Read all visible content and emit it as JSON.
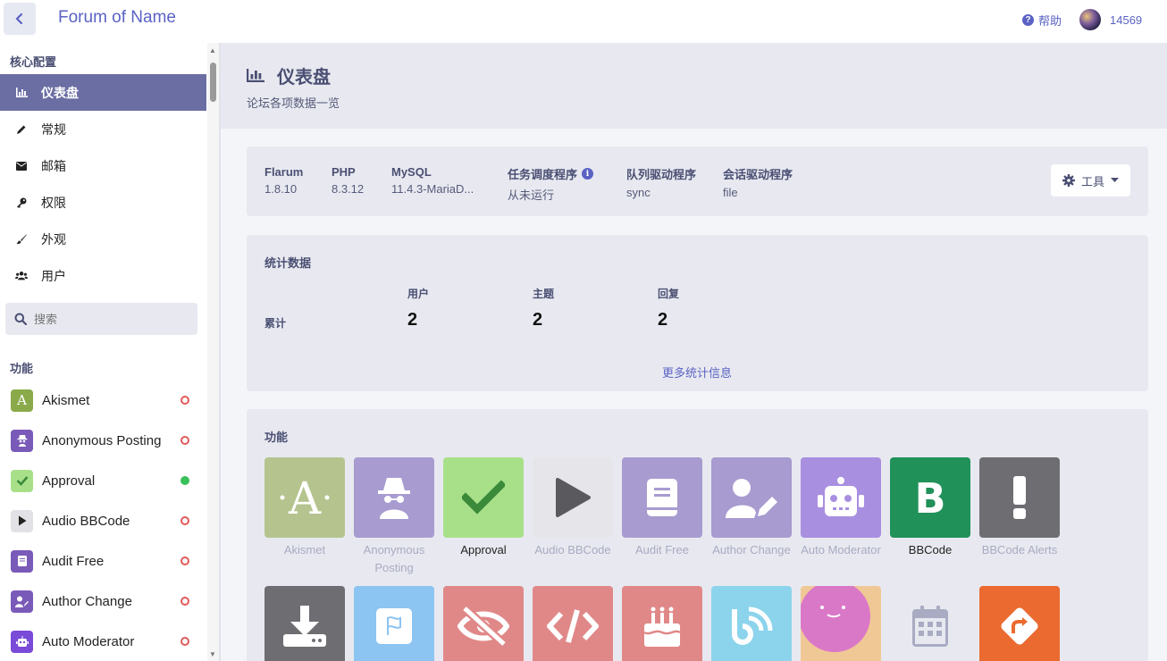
{
  "header": {
    "forum_title": "Forum of Name",
    "help_label": "帮助",
    "username": "14569"
  },
  "sidebar": {
    "core_heading": "核心配置",
    "nav": [
      {
        "label": "仪表盘",
        "icon": "chart-bar-icon",
        "active": true
      },
      {
        "label": "常规",
        "icon": "pencil-icon"
      },
      {
        "label": "邮箱",
        "icon": "envelope-icon"
      },
      {
        "label": "权限",
        "icon": "key-icon"
      },
      {
        "label": "外观",
        "icon": "paintbrush-icon"
      },
      {
        "label": "用户",
        "icon": "users-icon"
      }
    ],
    "search_placeholder": "搜索",
    "features_heading": "功能",
    "extensions": [
      {
        "label": "Akismet",
        "enabled": false,
        "color": "#a9c07a"
      },
      {
        "label": "Anonymous Posting",
        "enabled": false,
        "color": "#7a5ab8"
      },
      {
        "label": "Approval",
        "enabled": true,
        "color": "#a8e08a"
      },
      {
        "label": "Audio BBCode",
        "enabled": false,
        "color": "#e2e2e6"
      },
      {
        "label": "Audit Free",
        "enabled": false,
        "color": "#7a5ab8"
      },
      {
        "label": "Author Change",
        "enabled": false,
        "color": "#7a5ab8"
      },
      {
        "label": "Auto Moderator",
        "enabled": false,
        "color": "#7a4ad8"
      }
    ]
  },
  "page": {
    "title": "仪表盘",
    "subtitle": "论坛各项数据一览"
  },
  "status": {
    "items": [
      {
        "label": "Flarum",
        "value": "1.8.10"
      },
      {
        "label": "PHP",
        "value": "8.3.12"
      },
      {
        "label": "MySQL",
        "value": "11.4.3-MariaD..."
      },
      {
        "label": "任务调度程序",
        "value": "从未运行",
        "info": true
      },
      {
        "label": "队列驱动程序",
        "value": "sync"
      },
      {
        "label": "会话驱动程序",
        "value": "file"
      }
    ],
    "tools_label": "工具"
  },
  "stats": {
    "heading": "统计数据",
    "columns": [
      "用户",
      "主题",
      "回复"
    ],
    "row_label": "累计",
    "values": [
      "2",
      "2",
      "2"
    ],
    "more_link": "更多统计信息"
  },
  "features": {
    "heading": "功能",
    "tiles": [
      {
        "label": "Akismet",
        "enabled": false,
        "color": "#b5c48f",
        "icon": "akismet-icon"
      },
      {
        "label": "Anonymous Posting",
        "enabled": false,
        "color": "#a89bd0",
        "icon": "spy-icon"
      },
      {
        "label": "Approval",
        "enabled": true,
        "color": "#a8e08a",
        "icon": "check-icon"
      },
      {
        "label": "Audio BBCode",
        "enabled": false,
        "color": "#e6e6ea",
        "icon": "play-icon"
      },
      {
        "label": "Audit Free",
        "enabled": false,
        "color": "#a89bd0",
        "icon": "book-icon"
      },
      {
        "label": "Author Change",
        "enabled": false,
        "color": "#a89bd0",
        "icon": "user-edit-icon"
      },
      {
        "label": "Auto Moderator",
        "enabled": false,
        "color": "#a98fe0",
        "icon": "robot-icon"
      },
      {
        "label": "BBCode",
        "enabled": true,
        "color": "#21915a",
        "icon": "bold-b-icon"
      },
      {
        "label": "BBCode Alerts",
        "enabled": false,
        "color": "#6e6e72",
        "icon": "exclamation-icon"
      },
      {
        "label": "",
        "enabled": false,
        "color": "#6e6e72",
        "icon": "download-icon"
      },
      {
        "label": "",
        "enabled": false,
        "color": "#8cc4f2",
        "icon": "flag-icon"
      },
      {
        "label": "",
        "enabled": false,
        "color": "#e08888",
        "icon": "eye-slash-icon"
      },
      {
        "label": "",
        "enabled": false,
        "color": "#e08888",
        "icon": "code-icon"
      },
      {
        "label": "",
        "enabled": false,
        "color": "#e08888",
        "icon": "birthday-cake-icon"
      },
      {
        "label": "",
        "enabled": false,
        "color": "#8cd4ec",
        "icon": "blog-icon"
      },
      {
        "label": "",
        "enabled": false,
        "color": "#f0c896",
        "icon": "smile-icon"
      },
      {
        "label": "",
        "enabled": false,
        "color": "#e8e9f0",
        "icon": "calendar-icon"
      },
      {
        "label": "",
        "enabled": false,
        "color": "#ea6a30",
        "icon": "direction-icon"
      }
    ]
  }
}
